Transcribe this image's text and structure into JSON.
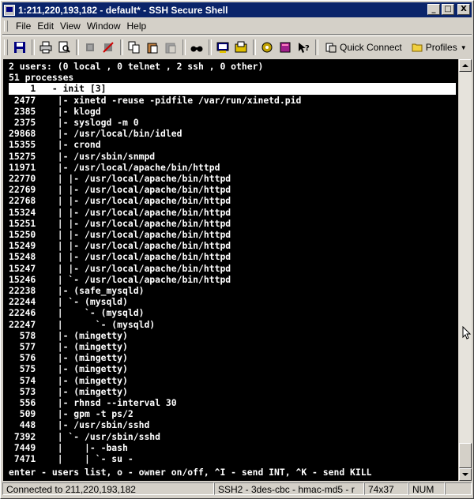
{
  "window": {
    "title": "1:211,220,193,182 - default* - SSH Secure Shell",
    "buttons": [
      "_",
      "□",
      "X"
    ]
  },
  "menu": [
    "File",
    "Edit",
    "View",
    "Window",
    "Help"
  ],
  "toolbar": {
    "icons": [
      "save-icon",
      "print-icon",
      "print-preview-icon",
      "connect-icon",
      "disconnect-icon",
      "copy-icon",
      "paste-icon",
      "paste-disabled-icon",
      "find-icon",
      "new-terminal-icon",
      "new-file-transfer-icon",
      "settings-icon",
      "profiles-book-icon",
      "help-icon"
    ],
    "quick_connect": "Quick Connect",
    "profiles": "Profiles"
  },
  "terminal": {
    "lines": [
      "2 users: (0 local , 0 telnet , 2 ssh , 0 other)",
      "51 processes",
      "    1   - init [3]",
      " 2477    |- xinetd -reuse -pidfile /var/run/xinetd.pid",
      " 2385    |- klogd",
      " 2375    |- syslogd -m 0",
      "29868    |- /usr/local/bin/idled",
      "15355    |- crond",
      "15275    |- /usr/sbin/snmpd",
      "11971    |- /usr/local/apache/bin/httpd",
      "22770    | |- /usr/local/apache/bin/httpd",
      "22769    | |- /usr/local/apache/bin/httpd",
      "22768    | |- /usr/local/apache/bin/httpd",
      "15324    | |- /usr/local/apache/bin/httpd",
      "15251    | |- /usr/local/apache/bin/httpd",
      "15250    | |- /usr/local/apache/bin/httpd",
      "15249    | |- /usr/local/apache/bin/httpd",
      "15248    | |- /usr/local/apache/bin/httpd",
      "15247    | |- /usr/local/apache/bin/httpd",
      "15246    | `- /usr/local/apache/bin/httpd",
      "22238    |- (safe_mysqld)",
      "22244    | `- (mysqld)",
      "22246    |    `- (mysqld)",
      "22247    |      `- (mysqld)",
      "  578    |- (mingetty)",
      "  577    |- (mingetty)",
      "  576    |- (mingetty)",
      "  575    |- (mingetty)",
      "  574    |- (mingetty)",
      "  573    |- (mingetty)",
      "  556    |- rhnsd --interval 30",
      "  509    |- gpm -t ps/2",
      "  448    |- /usr/sbin/sshd",
      " 7392    | `- /usr/sbin/sshd",
      " 7449    |    |- -bash",
      " 7471    |    | `- su -",
      "enter - users list, o - owner on/off, ^I - send INT, ^K - send KILL"
    ],
    "highlight_index": 2
  },
  "status": {
    "connection": "Connected to 211,220,193,182",
    "cipher": "SSH2 - 3des-cbc - hmac-md5 - r",
    "size": "74x37",
    "num": "NUM"
  }
}
